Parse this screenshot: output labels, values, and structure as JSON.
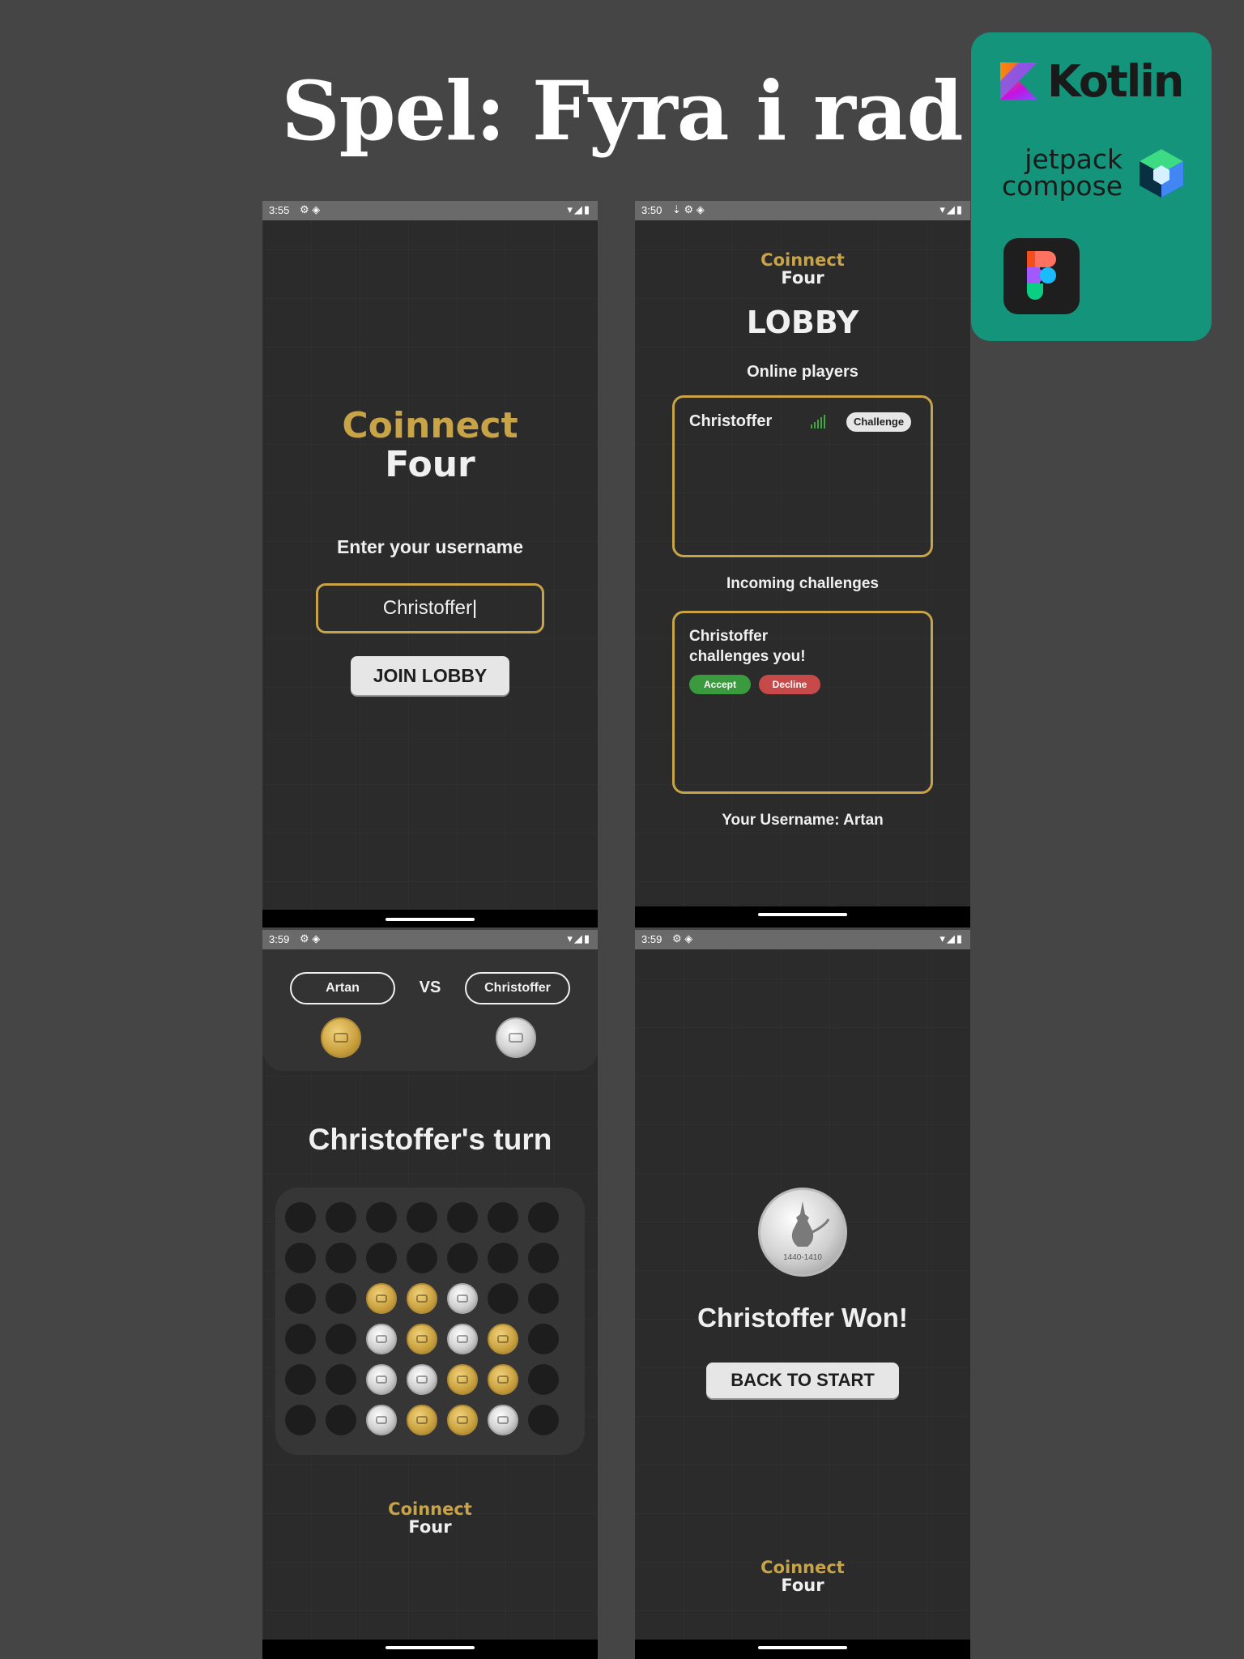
{
  "page_title": "Spel: Fyra i rad",
  "tech_stack": {
    "kotlin_label": "Kotlin",
    "jetpack_line1": "jetpack",
    "jetpack_line2": "compose"
  },
  "logo": {
    "line1": "Coinnect",
    "line2": "Four"
  },
  "colors": {
    "gold": "#c9a447",
    "background": "#2b2b2b",
    "tech_panel": "#14947a",
    "accept": "#3a9a3e",
    "decline": "#c64a4a"
  },
  "screens": {
    "login": {
      "status_time": "3:55",
      "prompt": "Enter your username",
      "username_value": "Christoffer",
      "join_button": "JOIN LOBBY"
    },
    "lobby": {
      "status_time": "3:50",
      "heading": "LOBBY",
      "online_heading": "Online players",
      "online_players": [
        {
          "name": "Christoffer",
          "button": "Challenge"
        }
      ],
      "incoming_heading": "Incoming challenges",
      "challenge_line1": "Christoffer",
      "challenge_line2": "challenges you!",
      "accept_button": "Accept",
      "decline_button": "Decline",
      "your_username": "Your Username: Artan"
    },
    "game": {
      "status_time": "3:59",
      "player1": "Artan",
      "vs": "VS",
      "player2": "Christoffer",
      "turn_text": "Christoffer's turn",
      "board": [
        [
          "e",
          "e",
          "e",
          "e",
          "e",
          "e",
          "e"
        ],
        [
          "e",
          "e",
          "e",
          "e",
          "e",
          "e",
          "e"
        ],
        [
          "e",
          "e",
          "g",
          "g",
          "s",
          "e",
          "e"
        ],
        [
          "e",
          "e",
          "s",
          "g",
          "s",
          "g",
          "e"
        ],
        [
          "e",
          "e",
          "s",
          "s",
          "g",
          "g",
          "e"
        ],
        [
          "e",
          "e",
          "s",
          "g",
          "g",
          "s",
          "e"
        ]
      ]
    },
    "win": {
      "status_time": "3:59",
      "winner_text": "Christoffer Won!",
      "back_button": "BACK TO START",
      "coin_inscription": "1440-1410"
    }
  }
}
